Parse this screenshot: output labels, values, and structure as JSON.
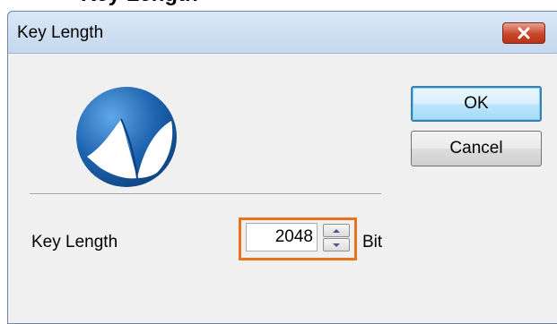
{
  "caption": "Key Length",
  "window": {
    "title": "Key Length",
    "close_icon": "close-icon"
  },
  "form": {
    "key_length_label": "Key Length",
    "key_length_value": "2048",
    "unit": "Bit"
  },
  "buttons": {
    "ok": "OK",
    "cancel": "Cancel"
  },
  "colors": {
    "highlight": "#e8731f",
    "close_button": "#c8462b",
    "logo_blue": "#1e64b0"
  }
}
